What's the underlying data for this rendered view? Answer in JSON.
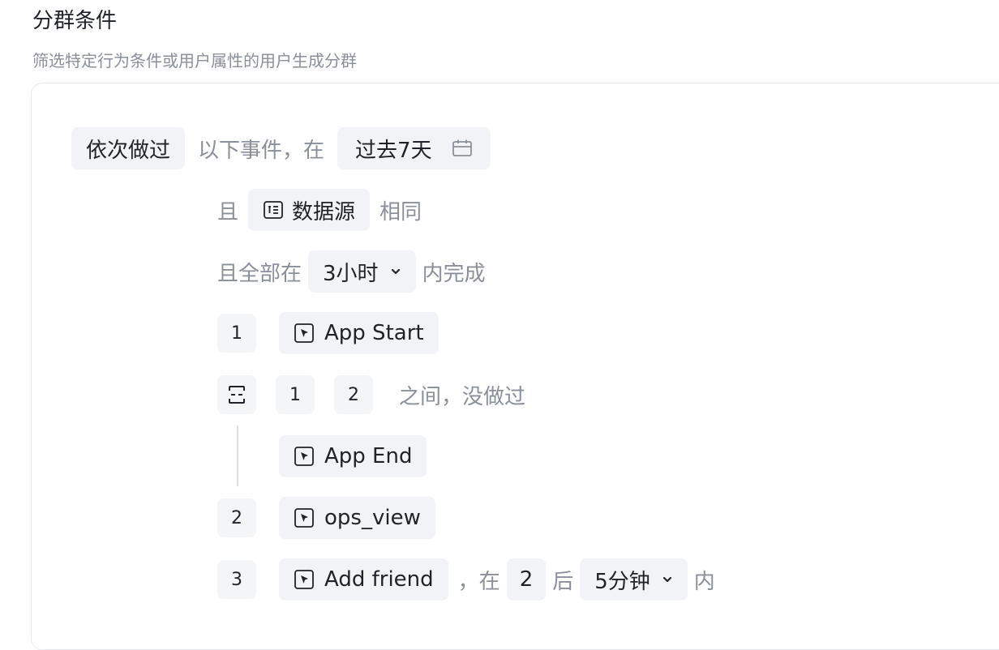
{
  "header": {
    "title": "分群条件",
    "subtitle": "筛选特定行为条件或用户属性的用户生成分群"
  },
  "condition": {
    "mode_label": "依次做过",
    "events_text": "以下事件，在",
    "time_range": "过去7天",
    "and_label": "且",
    "same_field": "数据源",
    "same_text": "相同",
    "all_within_label": "且全部在",
    "window_value": "3小时",
    "complete_text": "内完成"
  },
  "steps": [
    {
      "index": "1",
      "event": "App Start"
    },
    {
      "index": "2",
      "event": "ops_view"
    },
    {
      "index": "3",
      "event": "Add friend"
    }
  ],
  "exclusion": {
    "from_step": "1",
    "to_step": "2",
    "text": "之间，没做过",
    "event": "App End"
  },
  "step3_condition": {
    "comma": "，",
    "at_label": "在",
    "ref_step": "2",
    "after_label": "后",
    "duration": "5分钟",
    "within_label": "内"
  },
  "icons": {
    "calendar": "calendar-icon",
    "datasource": "datasource-icon",
    "chevron": "chevron-down-icon",
    "event": "event-cursor-icon",
    "exclude": "exclude-bracket-icon"
  }
}
